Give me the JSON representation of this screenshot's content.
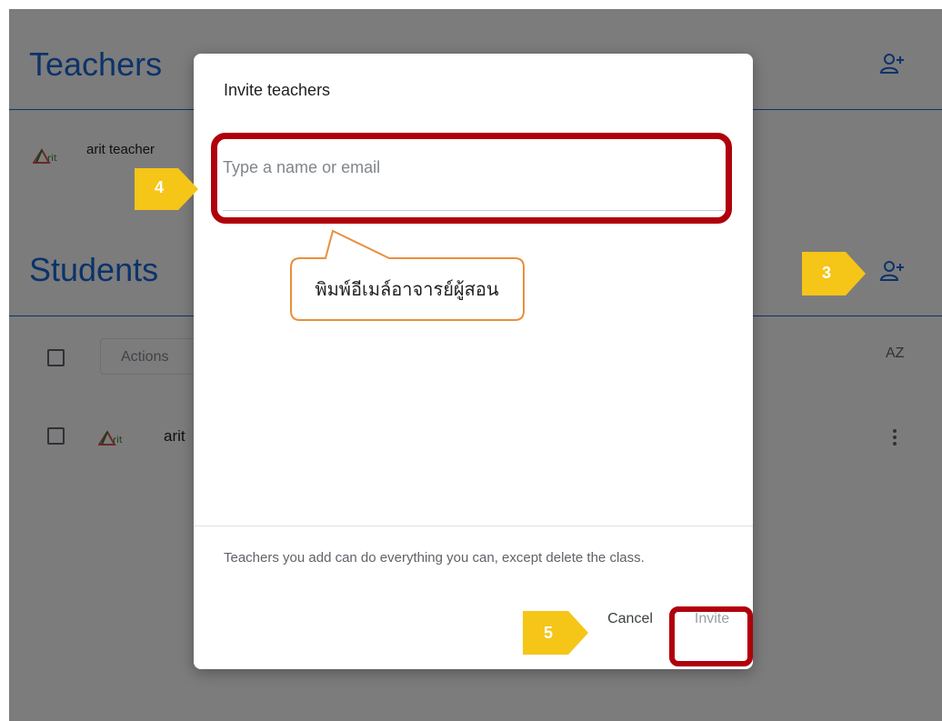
{
  "background": {
    "teachers_title": "Teachers",
    "teacher_row_name": "arit teacher",
    "students_title": "Students",
    "actions_label": "Actions",
    "sort_label": "AZ",
    "student_row_name": "arit"
  },
  "dialog": {
    "title": "Invite teachers",
    "input_placeholder": "Type a name or email",
    "input_value": "",
    "footer_note": "Teachers you add can do everything you can, except delete the class.",
    "cancel_label": "Cancel",
    "invite_label": "Invite"
  },
  "annotations": {
    "callout_text": "พิมพ์อีเมล์อาจารย์ผู้สอน",
    "step_3": "3",
    "step_4": "4",
    "step_5": "5"
  },
  "colors": {
    "accent": "#1967d2",
    "highlight": "#b0000b",
    "step_marker": "#f5c518",
    "callout_border": "#e8903d"
  }
}
